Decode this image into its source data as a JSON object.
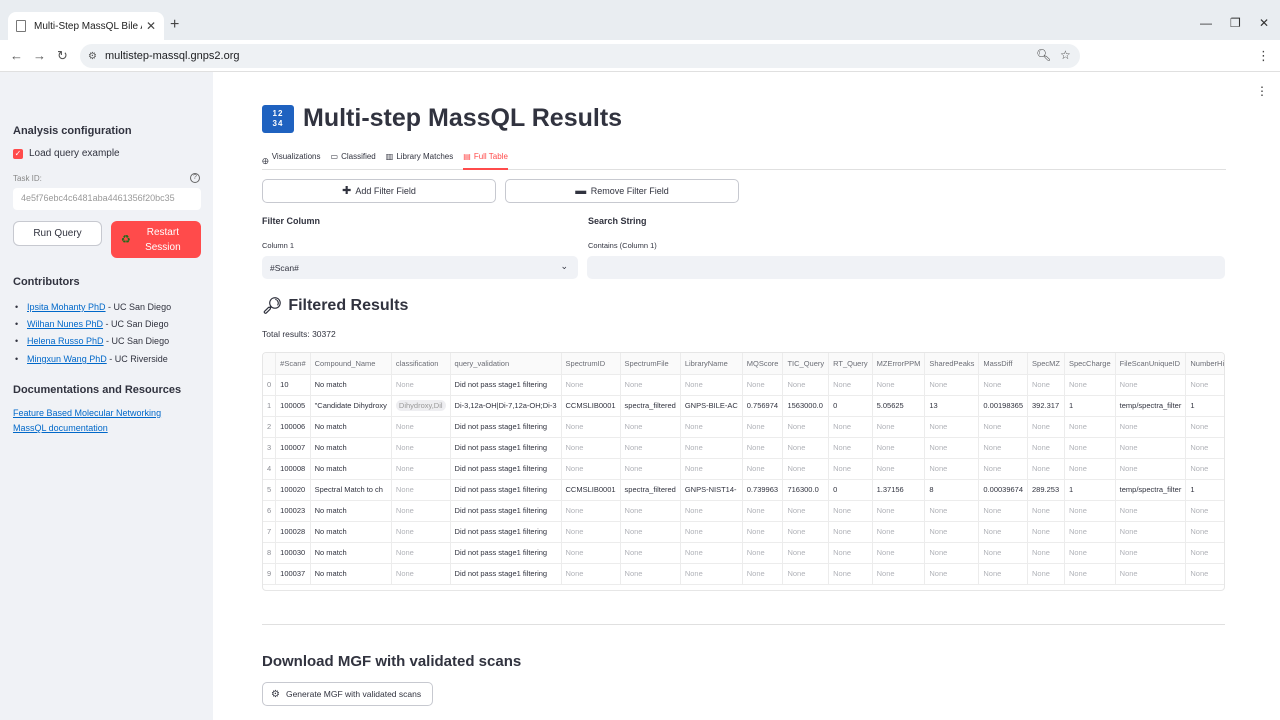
{
  "browser": {
    "tab_title": "Multi-Step MassQL Bile Acid Is",
    "url": "multistep-massql.gnps2.org"
  },
  "sidebar": {
    "analysis_header": "Analysis configuration",
    "load_example_label": "Load query example",
    "task_label": "Task ID:",
    "task_placeholder": "4e5f76ebc4c6481aba4461356f20bc35",
    "run_button": "Run Query",
    "restart_button": "Restart Session",
    "contributors_header": "Contributors",
    "contributors": [
      {
        "name": "Ipsita Mohanty PhD",
        "affiliation": " - UC San Diego"
      },
      {
        "name": "Wilhan Nunes PhD",
        "affiliation": " - UC San Diego"
      },
      {
        "name": "Helena Russo PhD",
        "affiliation": " - UC San Diego"
      },
      {
        "name": "Mingxun Wang PhD",
        "affiliation": " - UC Riverside"
      }
    ],
    "docs_header": "Documentations and Resources",
    "docs_links": [
      "Feature Based Molecular Networking",
      "MassQL documentation"
    ]
  },
  "main": {
    "title": "Multi-step MassQL Results",
    "tabs": [
      {
        "label": "Visualizations",
        "icon": "🜨"
      },
      {
        "label": "Classified",
        "icon": "▭"
      },
      {
        "label": "Library Matches",
        "icon": "▥"
      },
      {
        "label": "Full Table",
        "icon": "▤"
      }
    ],
    "add_filter": "Add Filter Field",
    "remove_filter": "Remove Filter Field",
    "filter_column_header": "Filter Column",
    "search_string_header": "Search String",
    "column_label": "Column 1",
    "contains_label": "Contains (Column 1)",
    "column_value": "#Scan#",
    "filtered_header": "Filtered Results",
    "total_results": "Total results: 30372",
    "download_header": "Download MGF with validated scans",
    "generate_button": "Generate MGF with validated scans"
  },
  "table": {
    "columns": [
      "",
      "#Scan#",
      "Compound_Name",
      "classification",
      "query_validation",
      "SpectrumID",
      "SpectrumFile",
      "LibraryName",
      "MQScore",
      "TIC_Query",
      "RT_Query",
      "MZErrorPPM",
      "SharedPeaks",
      "MassDiff",
      "SpecMZ",
      "SpecCharge",
      "FileScanUniqueID",
      "NumberHits"
    ],
    "rows": [
      [
        "0",
        "10",
        "No match",
        "None",
        "Did not pass stage1 filtering",
        "None",
        "None",
        "None",
        "None",
        "None",
        "None",
        "None",
        "None",
        "None",
        "None",
        "None",
        "None",
        "None"
      ],
      [
        "1",
        "100005",
        "\"Candidate Dihydroxy",
        "Dihydroxy,Dil",
        "Di-3,12a-OH|Di-7,12a-OH;Di-3",
        "CCMSLIB0001",
        "spectra_filtered",
        "GNPS-BILE-AC",
        "0.756974",
        "1563000.0",
        "0",
        "5.05625",
        "13",
        "0.00198365",
        "392.317",
        "1",
        "temp/spectra_filter",
        "1"
      ],
      [
        "2",
        "100006",
        "No match",
        "None",
        "Did not pass stage1 filtering",
        "None",
        "None",
        "None",
        "None",
        "None",
        "None",
        "None",
        "None",
        "None",
        "None",
        "None",
        "None",
        "None"
      ],
      [
        "3",
        "100007",
        "No match",
        "None",
        "Did not pass stage1 filtering",
        "None",
        "None",
        "None",
        "None",
        "None",
        "None",
        "None",
        "None",
        "None",
        "None",
        "None",
        "None",
        "None"
      ],
      [
        "4",
        "100008",
        "No match",
        "None",
        "Did not pass stage1 filtering",
        "None",
        "None",
        "None",
        "None",
        "None",
        "None",
        "None",
        "None",
        "None",
        "None",
        "None",
        "None",
        "None"
      ],
      [
        "5",
        "100020",
        "Spectral Match to ch",
        "None",
        "Did not pass stage1 filtering",
        "CCMSLIB0001",
        "spectra_filtered",
        "GNPS-NIST14-",
        "0.739963",
        "716300.0",
        "0",
        "1.37156",
        "8",
        "0.00039674",
        "289.253",
        "1",
        "temp/spectra_filter",
        "1"
      ],
      [
        "6",
        "100023",
        "No match",
        "None",
        "Did not pass stage1 filtering",
        "None",
        "None",
        "None",
        "None",
        "None",
        "None",
        "None",
        "None",
        "None",
        "None",
        "None",
        "None",
        "None"
      ],
      [
        "7",
        "100028",
        "No match",
        "None",
        "Did not pass stage1 filtering",
        "None",
        "None",
        "None",
        "None",
        "None",
        "None",
        "None",
        "None",
        "None",
        "None",
        "None",
        "None",
        "None"
      ],
      [
        "8",
        "100030",
        "No match",
        "None",
        "Did not pass stage1 filtering",
        "None",
        "None",
        "None",
        "None",
        "None",
        "None",
        "None",
        "None",
        "None",
        "None",
        "None",
        "None",
        "None"
      ],
      [
        "9",
        "100037",
        "No match",
        "None",
        "Did not pass stage1 filtering",
        "None",
        "None",
        "None",
        "None",
        "None",
        "None",
        "None",
        "None",
        "None",
        "None",
        "None",
        "None",
        "None"
      ]
    ]
  },
  "colors": {
    "accent": "#ff4b4b",
    "link": "#0068c9",
    "sidebar_bg": "#f0f2f6"
  }
}
